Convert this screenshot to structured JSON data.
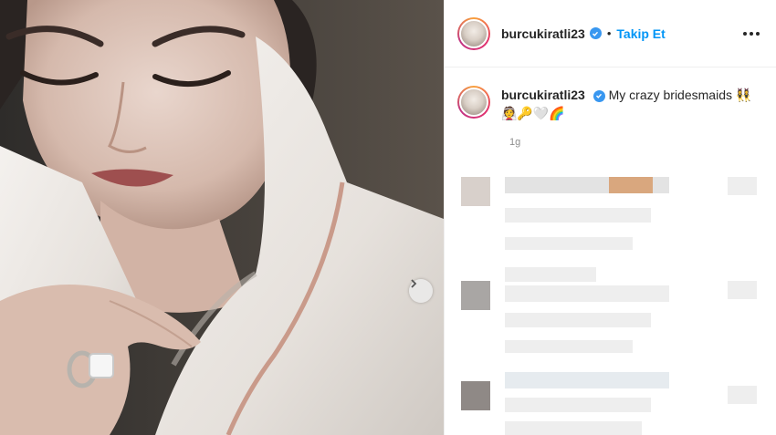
{
  "post": {
    "author": "burcukiratli23",
    "follow_label": "Takip Et",
    "separator": "•",
    "caption_text": "My crazy bridesmaids",
    "caption_emojis": "👯‍♀️👰🔑🤍🌈",
    "time_ago": "1g"
  },
  "colors": {
    "accent": "#0095f6",
    "verified": "#3897f0",
    "text": "#262626",
    "muted": "#8e8e8e"
  },
  "icons": {
    "verified": "verified-badge-icon",
    "more": "more-options-icon",
    "next": "chevron-right-icon"
  }
}
